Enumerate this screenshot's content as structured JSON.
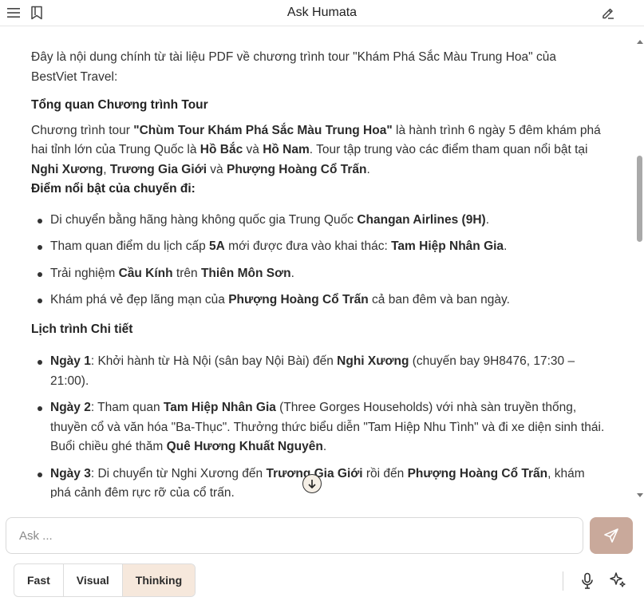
{
  "header": {
    "title": "Ask Humata",
    "menu_icon": "hamburger-menu-icon",
    "bookmark_icon": "bookmark-icon",
    "edit_icon": "edit-pencil-icon"
  },
  "answer": {
    "intro": "Đây là nội dung chính từ tài liệu PDF về chương trình tour \"Khám Phá Sắc Màu Trung Hoa\" của BestViet Travel:",
    "overview_heading": "Tổng quan Chương trình Tour",
    "overview": {
      "t1": "Chương trình tour ",
      "b1": "\"Chùm Tour Khám Phá Sắc Màu Trung Hoa\"",
      "t2": " là hành trình 6 ngày 5 đêm khám phá hai tỉnh lớn của Trung Quốc là ",
      "b2": "Hồ Bắc",
      "t3": " và ",
      "b3": "Hồ Nam",
      "t4": ". Tour tập trung vào các điểm tham quan nổi bật tại ",
      "b4": "Nghi Xương",
      "t5": ", ",
      "b5": "Trương Gia Giới",
      "t6": " và ",
      "b6": "Phượng Hoàng Cổ Trấn",
      "t7": "."
    },
    "highlights_heading": "Điểm nổi bật của chuyến đi:",
    "highlights": [
      {
        "t1": "Di chuyển bằng hãng hàng không quốc gia Trung Quốc ",
        "b1": "Changan Airlines (9H)",
        "t2": "."
      },
      {
        "t1": "Tham quan điểm du lịch cấp ",
        "b1": "5A",
        "t2": " mới được đưa vào khai thác: ",
        "b2": "Tam Hiệp Nhân Gia",
        "t3": "."
      },
      {
        "t1": "Trải nghiệm ",
        "b1": "Cầu Kính",
        "t2": " trên ",
        "b2": "Thiên Môn Sơn",
        "t3": "."
      },
      {
        "t1": "Khám phá vẻ đẹp lãng mạn của ",
        "b1": "Phượng Hoàng Cổ Trấn",
        "t2": " cả ban đêm và ban ngày."
      }
    ],
    "itinerary_heading": "Lịch trình Chi tiết",
    "itinerary": [
      {
        "b1": "Ngày 1",
        "t1": ": Khởi hành từ Hà Nội (sân bay Nội Bài) đến ",
        "b2": "Nghi Xương",
        "t2": " (chuyến bay 9H8476, 17:30 – 21:00)."
      },
      {
        "b1": "Ngày 2",
        "t1": ": Tham quan ",
        "b2": "Tam Hiệp Nhân Gia",
        "t2": " (Three Gorges Households) với nhà sàn truyền thống, thuyền cổ và văn hóa \"Ba-Thục\". Thưởng thức biểu diễn \"Tam Hiệp Nhu Tình\" và đi xe diện sinh thái. Buổi chiều ghé thăm ",
        "b3": "Quê Hương Khuất Nguyên",
        "t3": "."
      },
      {
        "b1": "Ngày 3",
        "t1": ": Di chuyển từ Nghi Xương đến ",
        "b2": "Trương Gia Giới",
        "t2": " rồi đến ",
        "b3": "Phượng Hoàng Cổ Trấn",
        "t3": ", khám phá cảnh đêm rực rỡ của cổ trấn."
      }
    ]
  },
  "composer": {
    "placeholder": "Ask ...",
    "send_icon": "send-arrow-icon",
    "modes": [
      "Fast",
      "Visual",
      "Thinking"
    ],
    "active_mode": "Thinking",
    "mic_icon": "microphone-icon",
    "sparkle_icon": "sparkle-icon"
  },
  "colors": {
    "send_button": "#c9a99b",
    "active_mode_bg": "#f6e8dc",
    "scroll_button_bg": "#f5efe6"
  }
}
